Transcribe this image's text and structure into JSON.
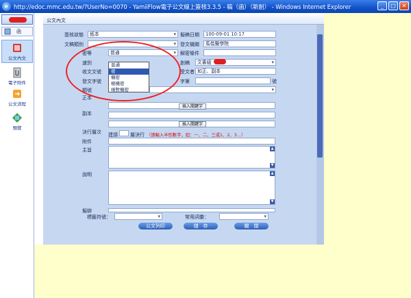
{
  "window": {
    "title": "http://edoc.mmc.edu.tw/?UserNo=0070 - YamiiFlow電子公文線上簽核3.3.5 - 稿（函）（新創） - Windows Internet Explorer",
    "controls": [
      "_",
      "□",
      "✕"
    ]
  },
  "nav": {
    "top_label": "函",
    "items": [
      {
        "label": "公文內文",
        "icon": "book-icon",
        "color": "#d23c3c"
      },
      {
        "label": "電子附件",
        "icon": "attachment-icon",
        "color": "#8a8f99"
      },
      {
        "label": "公文流程",
        "icon": "flow-icon",
        "color": "#e08a20"
      },
      {
        "label": "預覽",
        "icon": "preview-icon",
        "color": "#3aa545"
      }
    ]
  },
  "tab": {
    "label": "公文內文"
  },
  "form": {
    "sign_status_label": "簽核狀態",
    "sign_status_value": "紙本",
    "draft_date_label": "擬稿日期",
    "draft_date_value": "100-09-01  10:17",
    "doc_type_label": "文稿類別",
    "doc_type_value": "",
    "issuer_label": "發文機關",
    "issuer_value": "馬偕醫學院",
    "security_label": "密等",
    "security_value": "普通",
    "decrypt_label": "解密條件",
    "decrypt_value": "",
    "speed_label": "速別",
    "speed_value": "",
    "draft_label": "創稿",
    "draft_value": "文書組",
    "receive_no_label": "收文文號",
    "receive_no_value": "",
    "recipient_label": "受文者",
    "recipient_value": "如正、副本",
    "send_no_label": "發文字號",
    "send_no_value": "",
    "word_label": "字第",
    "no_suffix": "號",
    "type_label": "類號",
    "main_label": "正本",
    "main_value": "",
    "insert_btn": "插入關鍵字",
    "copy_label": "副本",
    "copy_value": "",
    "level_label": "決行層次",
    "level_prefix": "建請",
    "level_mid": "層決行",
    "level_hint": "（請輸入半形數字，如：一、二、三或1、2、3…）",
    "attach_label": "附件",
    "attach_value": "",
    "subject_label": "主旨",
    "subject_value": "",
    "desc_label": "說明",
    "desc_value": "",
    "proposal_label": "擬辦",
    "tag_label": "標籤符號：",
    "phrase_label": "常用詞彙：",
    "print_btn": "公文列印",
    "save_btn": "儲　存",
    "close_btn": "關　閉"
  },
  "dropdown": {
    "options": [
      "普通",
      "密",
      "機密",
      "極機密",
      "絕對機密"
    ],
    "highlighted_index": 1
  }
}
